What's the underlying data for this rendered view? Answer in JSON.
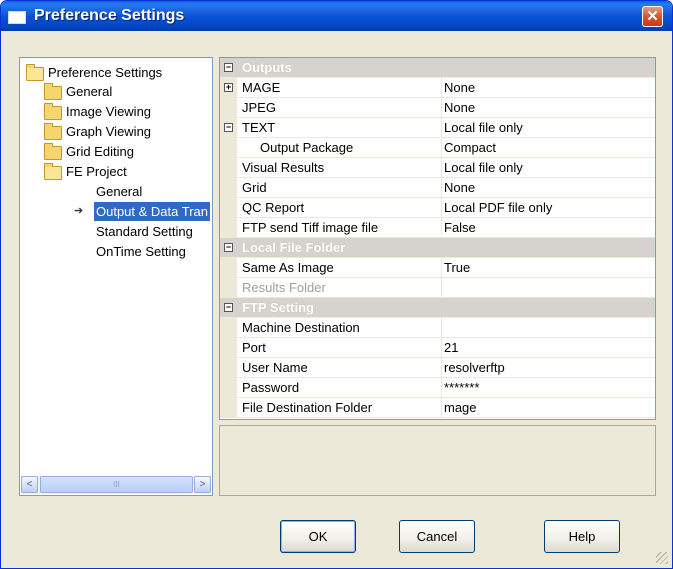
{
  "window": {
    "title": "Preference Settings",
    "close_label": "✕"
  },
  "tree": {
    "items": [
      {
        "label": "Preference Settings",
        "icon": "folder-open-icon",
        "selected": false
      },
      {
        "label": "General",
        "icon": "folder-icon",
        "selected": false
      },
      {
        "label": "Image Viewing",
        "icon": "folder-icon",
        "selected": false
      },
      {
        "label": "Graph Viewing",
        "icon": "folder-icon",
        "selected": false
      },
      {
        "label": "Grid Editing",
        "icon": "folder-icon",
        "selected": false
      },
      {
        "label": "FE Project",
        "icon": "folder-open-icon",
        "selected": false
      },
      {
        "label": "General",
        "icon": "",
        "selected": false
      },
      {
        "label": "Output & Data Tran",
        "icon": "arrow-right-icon",
        "selected": true
      },
      {
        "label": "Standard Setting",
        "icon": "",
        "selected": false
      },
      {
        "label": "OnTime Setting",
        "icon": "",
        "selected": false
      }
    ],
    "scroll": {
      "left": "<",
      "right": ">",
      "thumb": "III"
    }
  },
  "grid": {
    "rows": [
      {
        "type": "cat",
        "expander": "−",
        "name": "Outputs",
        "value": ""
      },
      {
        "type": "prop",
        "expander": "+",
        "name": "MAGE",
        "value": "None"
      },
      {
        "type": "prop",
        "expander": "",
        "name": "JPEG",
        "value": "None"
      },
      {
        "type": "prop",
        "expander": "−",
        "name": "TEXT",
        "value": "Local file only"
      },
      {
        "type": "sub",
        "expander": "",
        "name": "Output Package",
        "value": "Compact"
      },
      {
        "type": "prop",
        "expander": "",
        "name": "Visual Results",
        "value": "Local file only"
      },
      {
        "type": "prop",
        "expander": "",
        "name": "Grid",
        "value": "None"
      },
      {
        "type": "prop",
        "expander": "",
        "name": "QC Report",
        "value": "Local PDF file only"
      },
      {
        "type": "prop",
        "expander": "",
        "name": "FTP send Tiff image file",
        "value": "False"
      },
      {
        "type": "cat",
        "expander": "−",
        "name": "Local File Folder",
        "value": ""
      },
      {
        "type": "prop",
        "expander": "",
        "name": "Same As Image",
        "value": "True"
      },
      {
        "type": "disabled",
        "expander": "",
        "name": "Results Folder",
        "value": ""
      },
      {
        "type": "cat",
        "expander": "−",
        "name": "FTP Setting",
        "value": ""
      },
      {
        "type": "prop",
        "expander": "",
        "name": "Machine Destination",
        "value": ""
      },
      {
        "type": "prop",
        "expander": "",
        "name": "Port",
        "value": "21"
      },
      {
        "type": "prop",
        "expander": "",
        "name": "User Name",
        "value": "resolverftp"
      },
      {
        "type": "prop",
        "expander": "",
        "name": "Password",
        "value": "*******"
      },
      {
        "type": "prop",
        "expander": "",
        "name": "File Destination Folder",
        "value": "mage"
      }
    ]
  },
  "buttons": {
    "ok": "OK",
    "cancel": "Cancel",
    "help": "Help"
  }
}
